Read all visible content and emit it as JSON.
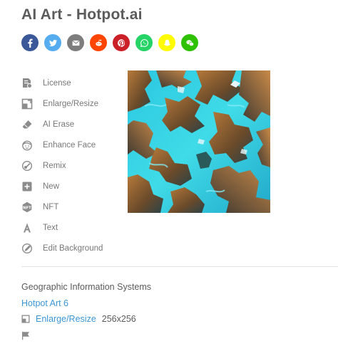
{
  "page": {
    "title": "AI Art - Hotpot.ai"
  },
  "share": [
    {
      "name": "facebook-share-button",
      "icon": "facebook-icon",
      "color": "#3b5998"
    },
    {
      "name": "twitter-share-button",
      "icon": "twitter-icon",
      "color": "#55acee"
    },
    {
      "name": "email-share-button",
      "icon": "email-icon",
      "color": "#7d7d7d"
    },
    {
      "name": "reddit-share-button",
      "icon": "reddit-icon",
      "color": "#ff4500"
    },
    {
      "name": "pinterest-share-button",
      "icon": "pinterest-icon",
      "color": "#cb2027"
    },
    {
      "name": "whatsapp-share-button",
      "icon": "whatsapp-icon",
      "color": "#25d366"
    },
    {
      "name": "snapchat-share-button",
      "icon": "snapchat-icon",
      "color": "#fffc00"
    },
    {
      "name": "wechat-share-button",
      "icon": "wechat-icon",
      "color": "#2dc100"
    }
  ],
  "menu": [
    {
      "name": "license",
      "label": "License",
      "icon": "license-icon"
    },
    {
      "name": "enlarge-resize",
      "label": "Enlarge/Resize",
      "icon": "enlarge-icon"
    },
    {
      "name": "ai-erase",
      "label": "AI Erase",
      "icon": "eraser-icon"
    },
    {
      "name": "enhance-face",
      "label": "Enhance Face",
      "icon": "face-icon"
    },
    {
      "name": "remix",
      "label": "Remix",
      "icon": "remix-icon"
    },
    {
      "name": "new",
      "label": "New",
      "icon": "plus-icon"
    },
    {
      "name": "nft",
      "label": "NFT",
      "icon": "nft-icon"
    },
    {
      "name": "text",
      "label": "Text",
      "icon": "text-icon"
    },
    {
      "name": "edit-background",
      "label": "Edit Background",
      "icon": "edit-background-icon"
    }
  ],
  "details": {
    "description": "Geographic Information Systems",
    "model": "Hotpot Art 6",
    "enlarge_label": "Enlarge/Resize",
    "size": "256x256"
  },
  "colors": {
    "link": "#3b96d6",
    "icon_gray": "#8c8c8c"
  }
}
